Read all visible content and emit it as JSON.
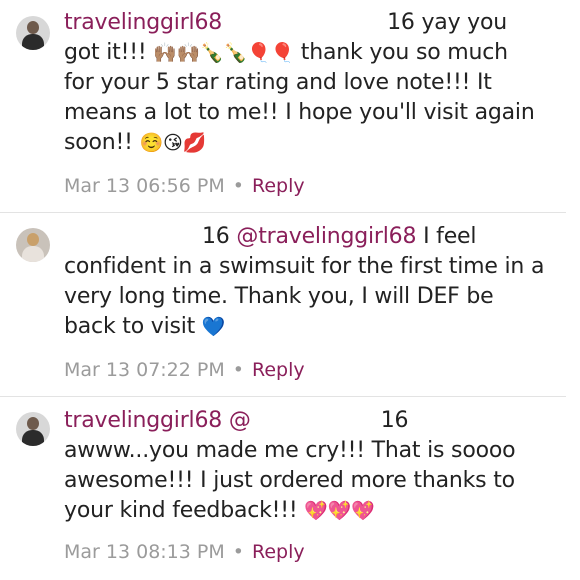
{
  "comments": [
    {
      "username": "travelinggirl68",
      "text_head": "16 yay you",
      "line2": "got it!!!",
      "emoji_a": "🙌🏽🙌🏽🍾🍾🎈🎈",
      "line2_tail": "thank you so much",
      "line3": "for your 5 star rating and love note!!!   It",
      "line4": "means a lot to me!!  I hope you'll visit again",
      "line5": "soon!!",
      "emoji_b": "☺️😘💋",
      "timestamp": "Mar 13 06:56 PM",
      "reply_label": "Reply"
    },
    {
      "text_head": "16",
      "mention": "@travelinggirl68",
      "line1_tail": "I feel",
      "line2": "confident in a swimsuit for the first time in a",
      "line3": "very long time. Thank you, I will DEF be",
      "line4": "back to visit",
      "emoji": "💙",
      "timestamp": "Mar 13 07:22 PM",
      "reply_label": "Reply"
    },
    {
      "username": "travelinggirl68",
      "mention_prefix": "@",
      "text_head": "16",
      "line2": "awww...you made me cry!!!  That is soooo",
      "line3": "awesome!!!  I just ordered more thanks to",
      "line4": "your kind feedback!!!",
      "emoji": "💖💖💖",
      "timestamp": "Mar 13 08:13 PM",
      "reply_label": "Reply"
    }
  ],
  "meta_separator": "•"
}
